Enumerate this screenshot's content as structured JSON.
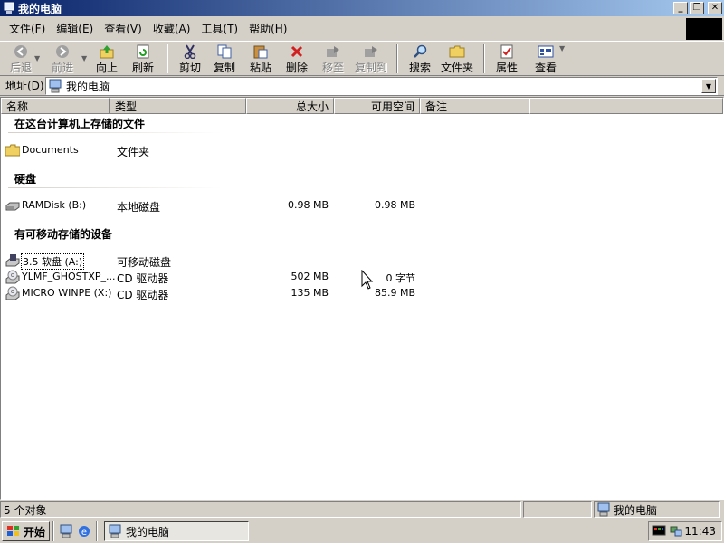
{
  "window": {
    "title": "我的电脑"
  },
  "menu": [
    "文件(F)",
    "编辑(E)",
    "查看(V)",
    "收藏(A)",
    "工具(T)",
    "帮助(H)"
  ],
  "toolbar": {
    "back": "后退",
    "forward": "前进",
    "up": "向上",
    "refresh": "刷新",
    "cut": "剪切",
    "copy": "复制",
    "paste": "粘贴",
    "delete": "删除",
    "moveto": "移至",
    "copyto": "复制到",
    "search": "搜索",
    "folders": "文件夹",
    "properties": "属性",
    "views": "查看"
  },
  "address": {
    "label": "地址(D)",
    "value": "我的电脑"
  },
  "columns": {
    "name": "名称",
    "type": "类型",
    "total": "总大小",
    "free": "可用空间",
    "comment": "备注"
  },
  "groups": [
    {
      "title": "在这台计算机上存储的文件",
      "items": [
        {
          "name": "Documents",
          "type": "文件夹",
          "total": "",
          "free": "",
          "icon": "folder-icon"
        }
      ]
    },
    {
      "title": "硬盘",
      "items": [
        {
          "name": "RAMDisk (B:)",
          "type": "本地磁盘",
          "total": "0.98 MB",
          "free": "0.98 MB",
          "icon": "hard-disk-icon"
        }
      ]
    },
    {
      "title": "有可移动存储的设备",
      "items": [
        {
          "name": "3.5 软盘 (A:)",
          "type": "可移动磁盘",
          "total": "",
          "free": "",
          "icon": "floppy-drive-icon"
        },
        {
          "name": "YLMF_GHOSTXP_...",
          "type": "CD 驱动器",
          "total": "502 MB",
          "free": "0 字节",
          "icon": "cd-drive-icon"
        },
        {
          "name": "MICRO WINPE (X:)",
          "type": "CD 驱动器",
          "total": "135 MB",
          "free": "85.9 MB",
          "icon": "cd-drive-icon"
        }
      ]
    }
  ],
  "status": {
    "count": "5 个对象",
    "location": "我的电脑"
  },
  "taskbar": {
    "start": "开始",
    "task": "我的电脑",
    "clock": "11:43"
  }
}
